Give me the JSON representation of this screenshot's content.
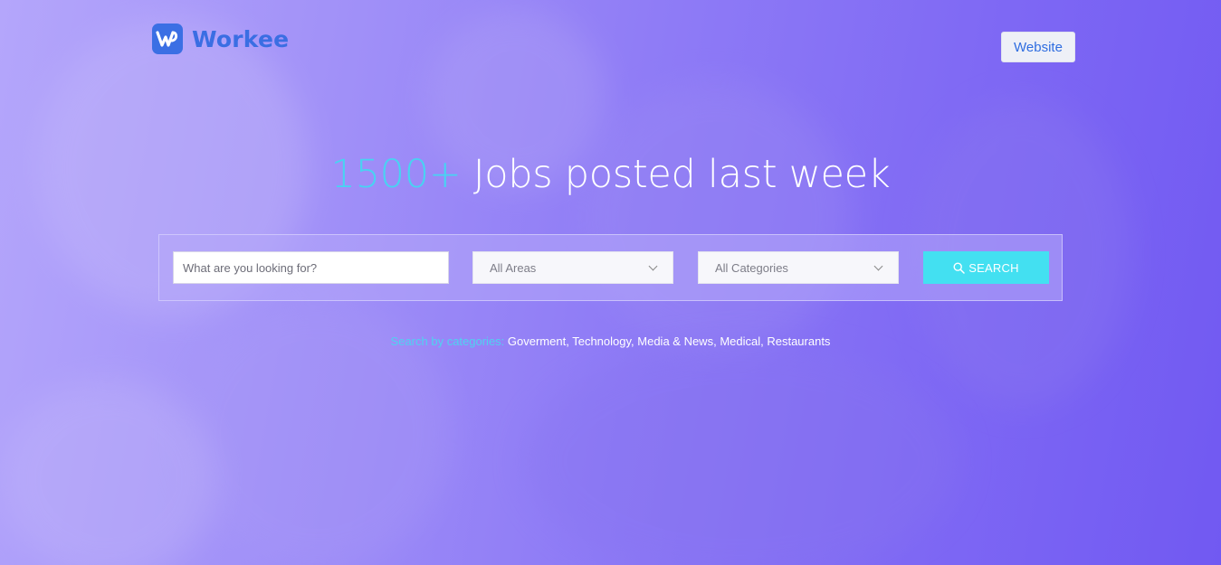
{
  "brand": {
    "name": "Workee",
    "logo_icon": "w-logo-icon",
    "color": "#3a6ee3"
  },
  "header": {
    "website_button": "Website"
  },
  "hero": {
    "headline_count": "1500+",
    "headline_text": " Jobs posted last week",
    "accent_color": "#48d3f2"
  },
  "search": {
    "placeholder": "What are you looking for?",
    "area_select": "All Areas",
    "category_select": "All Categories",
    "button_label": "SEARCH",
    "button_icon": "search-icon",
    "button_color": "#43e0f1"
  },
  "categories": {
    "label": "Search by categories:",
    "items": [
      {
        "name": "Goverment",
        "separator": ", "
      },
      {
        "name": "Technology",
        "separator": ", "
      },
      {
        "name": "Media & News",
        "separator": ", "
      },
      {
        "name": "Medical",
        "separator": ", "
      },
      {
        "name": "Restaurants",
        "separator": ""
      }
    ]
  }
}
